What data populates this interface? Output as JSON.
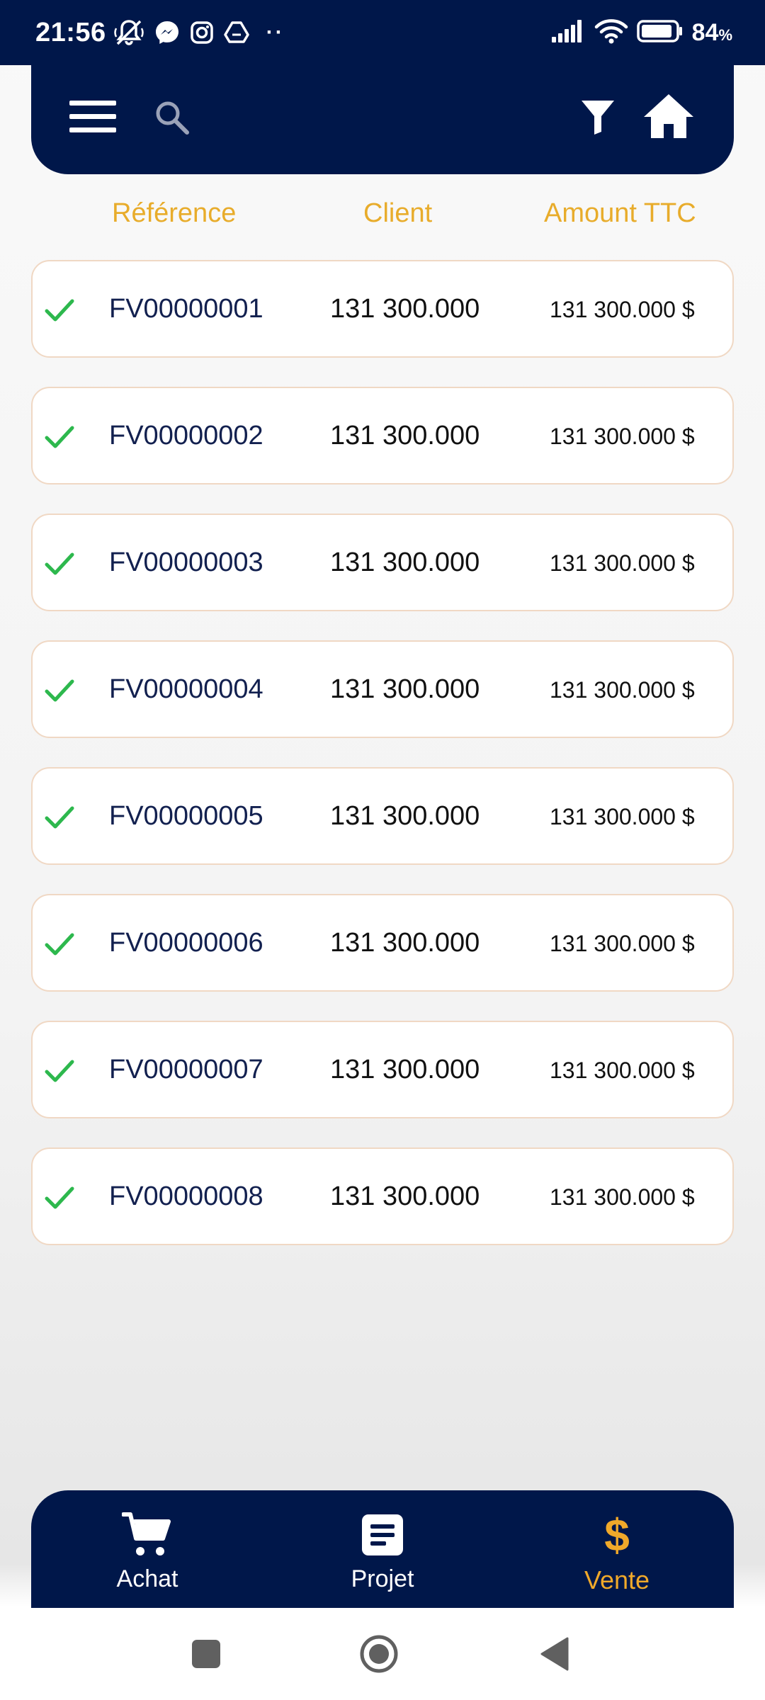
{
  "status_bar": {
    "time": "21:56",
    "battery_percent": "84",
    "battery_unit": "%",
    "overflow_dots": "··",
    "icons": [
      "mute-icon",
      "messenger-icon",
      "instagram-icon",
      "drive-icon",
      "signal-icon",
      "wifi-icon",
      "battery-icon"
    ]
  },
  "header": {
    "icons": [
      "menu-icon",
      "search-icon",
      "filter-icon",
      "home-icon"
    ]
  },
  "table": {
    "columns": [
      "Référence",
      "Client",
      "Amount TTC"
    ],
    "rows": [
      {
        "status": "check-icon",
        "reference": "FV00000001",
        "client": "131 300.000",
        "amount": "131 300.000 $"
      },
      {
        "status": "check-icon",
        "reference": "FV00000002",
        "client": "131 300.000",
        "amount": "131 300.000 $"
      },
      {
        "status": "check-icon",
        "reference": "FV00000003",
        "client": "131 300.000",
        "amount": "131 300.000 $"
      },
      {
        "status": "check-icon",
        "reference": "FV00000004",
        "client": "131 300.000",
        "amount": "131 300.000 $"
      },
      {
        "status": "check-icon",
        "reference": "FV00000005",
        "client": "131 300.000",
        "amount": "131 300.000 $"
      },
      {
        "status": "check-icon",
        "reference": "FV00000006",
        "client": "131 300.000",
        "amount": "131 300.000 $"
      },
      {
        "status": "check-icon",
        "reference": "FV00000007",
        "client": "131 300.000",
        "amount": "131 300.000 $"
      },
      {
        "status": "check-icon",
        "reference": "FV00000008",
        "client": "131 300.000",
        "amount": "131 300.000 $"
      }
    ]
  },
  "bottom_nav": {
    "items": [
      {
        "label": "Achat",
        "icon": "cart-icon",
        "active": false
      },
      {
        "label": "Projet",
        "icon": "document-icon",
        "active": false
      },
      {
        "label": "Vente",
        "icon": "dollar-icon",
        "active": true,
        "glyph": "$"
      }
    ]
  },
  "colors": {
    "navy": "#00174a",
    "accent": "#f0a92a",
    "check": "#2db84d",
    "row_border": "#f0d8c4"
  }
}
